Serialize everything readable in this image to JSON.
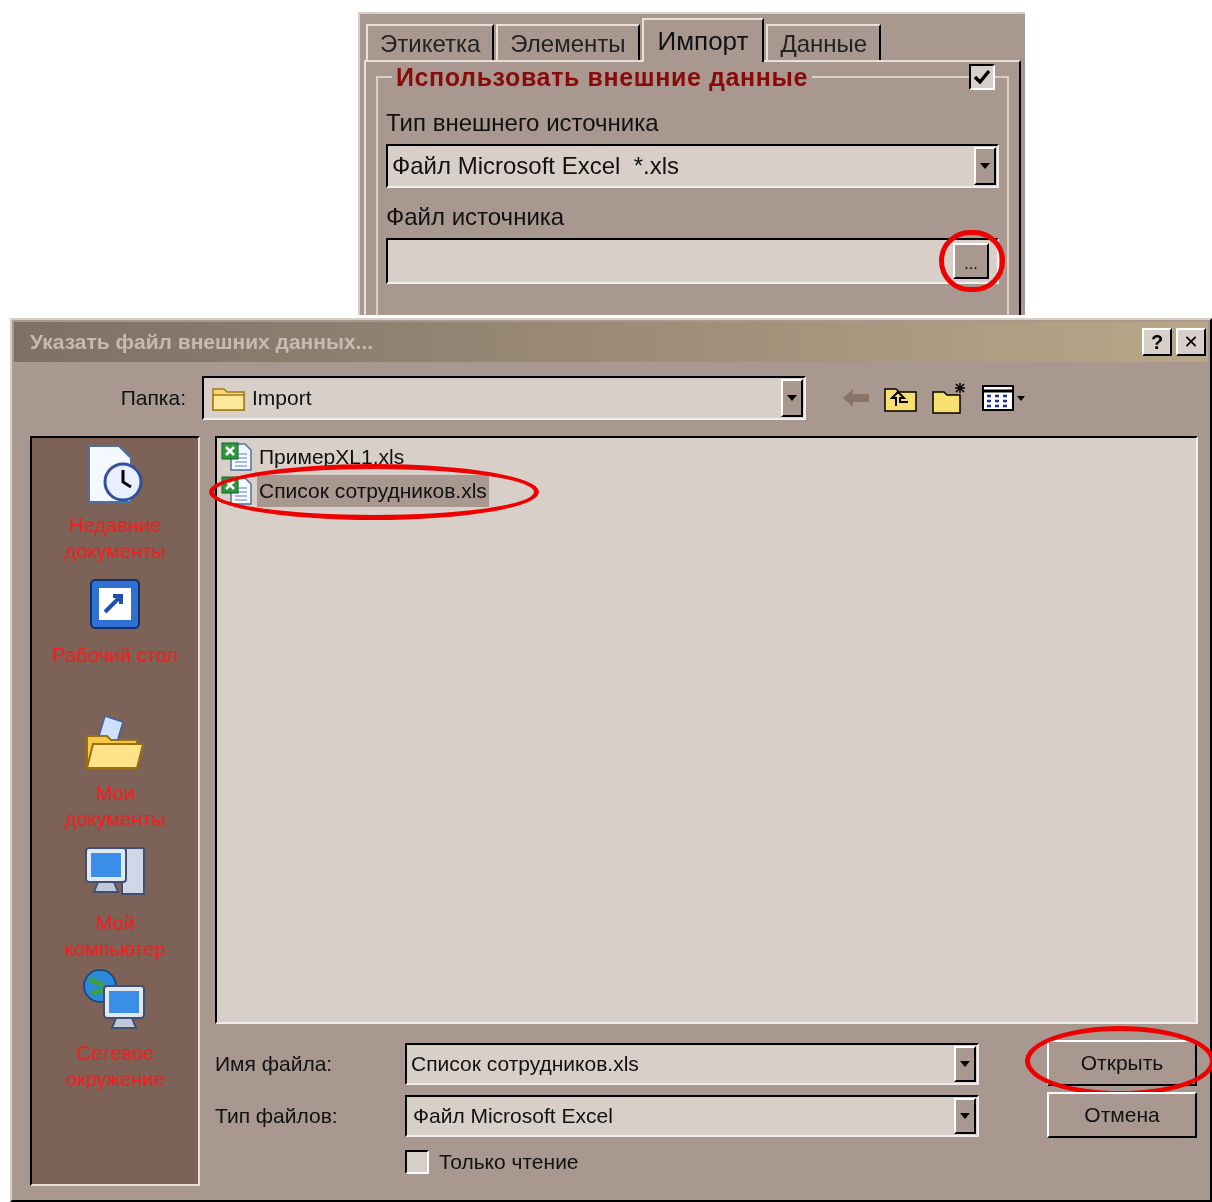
{
  "settings_panel": {
    "tabs": [
      {
        "label": "Этикетка",
        "selected": false
      },
      {
        "label": "Элементы",
        "selected": false
      },
      {
        "label": "Импорт",
        "selected": true
      },
      {
        "label": "Данные",
        "selected": false
      }
    ],
    "group": {
      "title": "Использовать внешние данные",
      "checked": true
    },
    "source_type": {
      "label": "Тип внешнего источника",
      "value": "Файл Microsoft Excel  *.xls"
    },
    "source_file": {
      "label": "Файл источника",
      "browse_button": "...",
      "browse_circled": true
    }
  },
  "dialog": {
    "title": "Указать файл внешних данных...",
    "help_button": "?",
    "close_button": "✕",
    "folder": {
      "label": "Папка:",
      "value": "Import"
    },
    "places": [
      {
        "label": "Недавние документы",
        "kind": "recent"
      },
      {
        "label": "Рабочий стол",
        "kind": "desktop"
      },
      {
        "label": "Мои документы",
        "kind": "documents"
      },
      {
        "label": "Мой компьютер",
        "kind": "computer"
      },
      {
        "label": "Сетевое окружение",
        "kind": "network"
      }
    ],
    "files": [
      {
        "name": "ПримерXL1.xls",
        "selected": false,
        "circled": false
      },
      {
        "name": "Список сотрудников.xls",
        "selected": true,
        "circled": true
      }
    ],
    "file_name": {
      "label": "Имя файла:",
      "value": "Список сотрудников.xls"
    },
    "file_type": {
      "label": "Тип файлов:",
      "value": "Файл Microsoft Excel"
    },
    "read_only": {
      "label": "Только чтение",
      "checked": false
    },
    "buttons": [
      {
        "label": "Открыть",
        "circled": true
      },
      {
        "label": "Отмена",
        "circled": false
      }
    ]
  }
}
